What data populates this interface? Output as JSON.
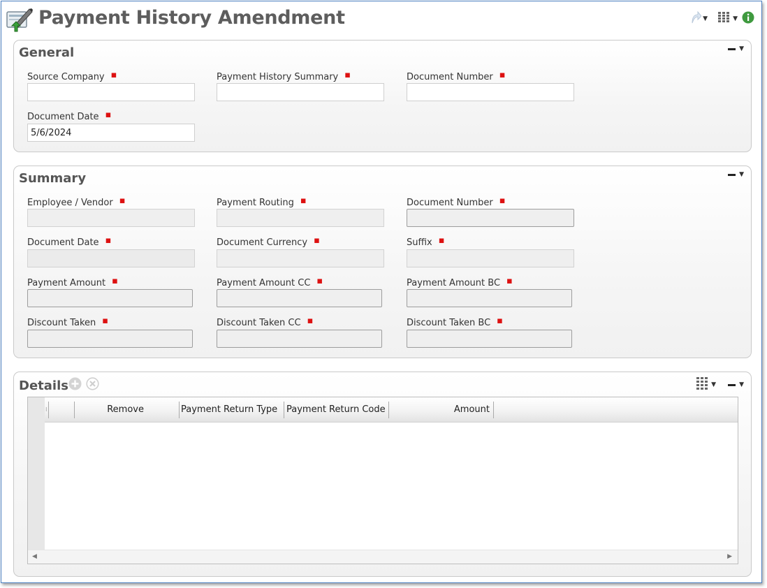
{
  "window": {
    "title": "Payment History Amendment",
    "icons": {
      "app": "edit-document-icon",
      "share": "share-icon",
      "columns": "columns-icon",
      "info": "info-icon"
    }
  },
  "general": {
    "title": "General",
    "fields": {
      "source_company": {
        "label": "Source Company",
        "value": ""
      },
      "payment_history_summary": {
        "label": "Payment History Summary",
        "value": ""
      },
      "document_number": {
        "label": "Document Number",
        "value": ""
      },
      "document_date": {
        "label": "Document Date",
        "value": "5/6/2024"
      }
    }
  },
  "summary": {
    "title": "Summary",
    "fields": {
      "employee_vendor": {
        "label": "Employee / Vendor"
      },
      "payment_routing": {
        "label": "Payment Routing"
      },
      "document_number": {
        "label": "Document Number"
      },
      "document_date": {
        "label": "Document Date"
      },
      "document_currency": {
        "label": "Document Currency"
      },
      "suffix": {
        "label": "Suffix"
      },
      "payment_amount": {
        "label": "Payment Amount"
      },
      "payment_amount_cc": {
        "label": "Payment Amount CC"
      },
      "payment_amount_bc": {
        "label": "Payment Amount BC"
      },
      "discount_taken": {
        "label": "Discount Taken"
      },
      "discount_taken_cc": {
        "label": "Discount Taken CC"
      },
      "discount_taken_bc": {
        "label": "Discount Taken BC"
      }
    }
  },
  "details": {
    "title": "Details",
    "columns": [
      "Remove",
      "Payment Return Type",
      "Payment Return Code",
      "Amount"
    ],
    "rows": []
  },
  "colors": {
    "required_marker": "#dd1111",
    "window_border": "#4a7fc0",
    "title_text": "#5d5d5d"
  }
}
